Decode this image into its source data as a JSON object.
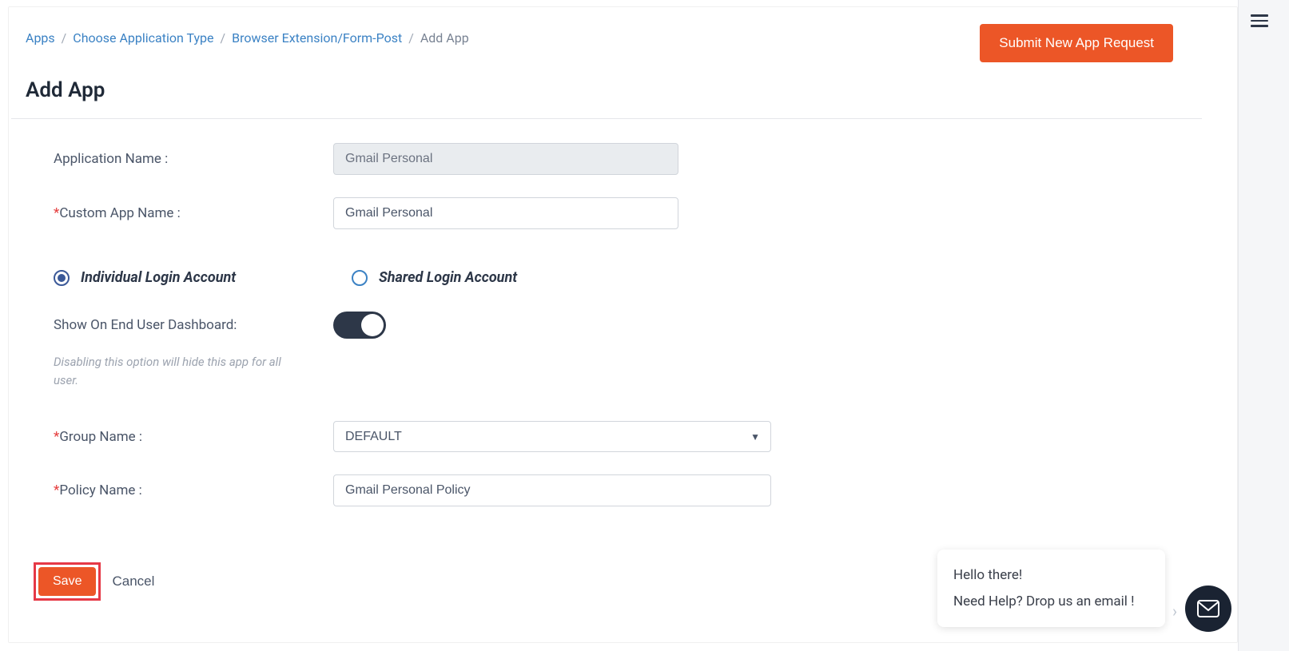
{
  "breadcrumb": {
    "items": [
      "Apps",
      "Choose Application Type",
      "Browser Extension/Form-Post"
    ],
    "current": "Add App"
  },
  "header": {
    "submit_label": "Submit New App Request",
    "page_title": "Add App"
  },
  "form": {
    "app_name_label": "Application Name :",
    "app_name_value": "Gmail Personal",
    "custom_name_label": "Custom App Name :",
    "custom_name_value": "Gmail Personal",
    "radio_individual": "Individual Login Account",
    "radio_shared": "Shared Login Account",
    "toggle_label": "Show On End User Dashboard:",
    "toggle_help": "Disabling this option will hide this app for all user.",
    "group_label": "Group Name :",
    "group_value": "DEFAULT",
    "policy_label": "Policy Name :",
    "policy_value": "Gmail Personal Policy"
  },
  "actions": {
    "save": "Save",
    "cancel": "Cancel"
  },
  "chat": {
    "line1": "Hello there!",
    "line2": "Need Help? Drop us an email !"
  }
}
